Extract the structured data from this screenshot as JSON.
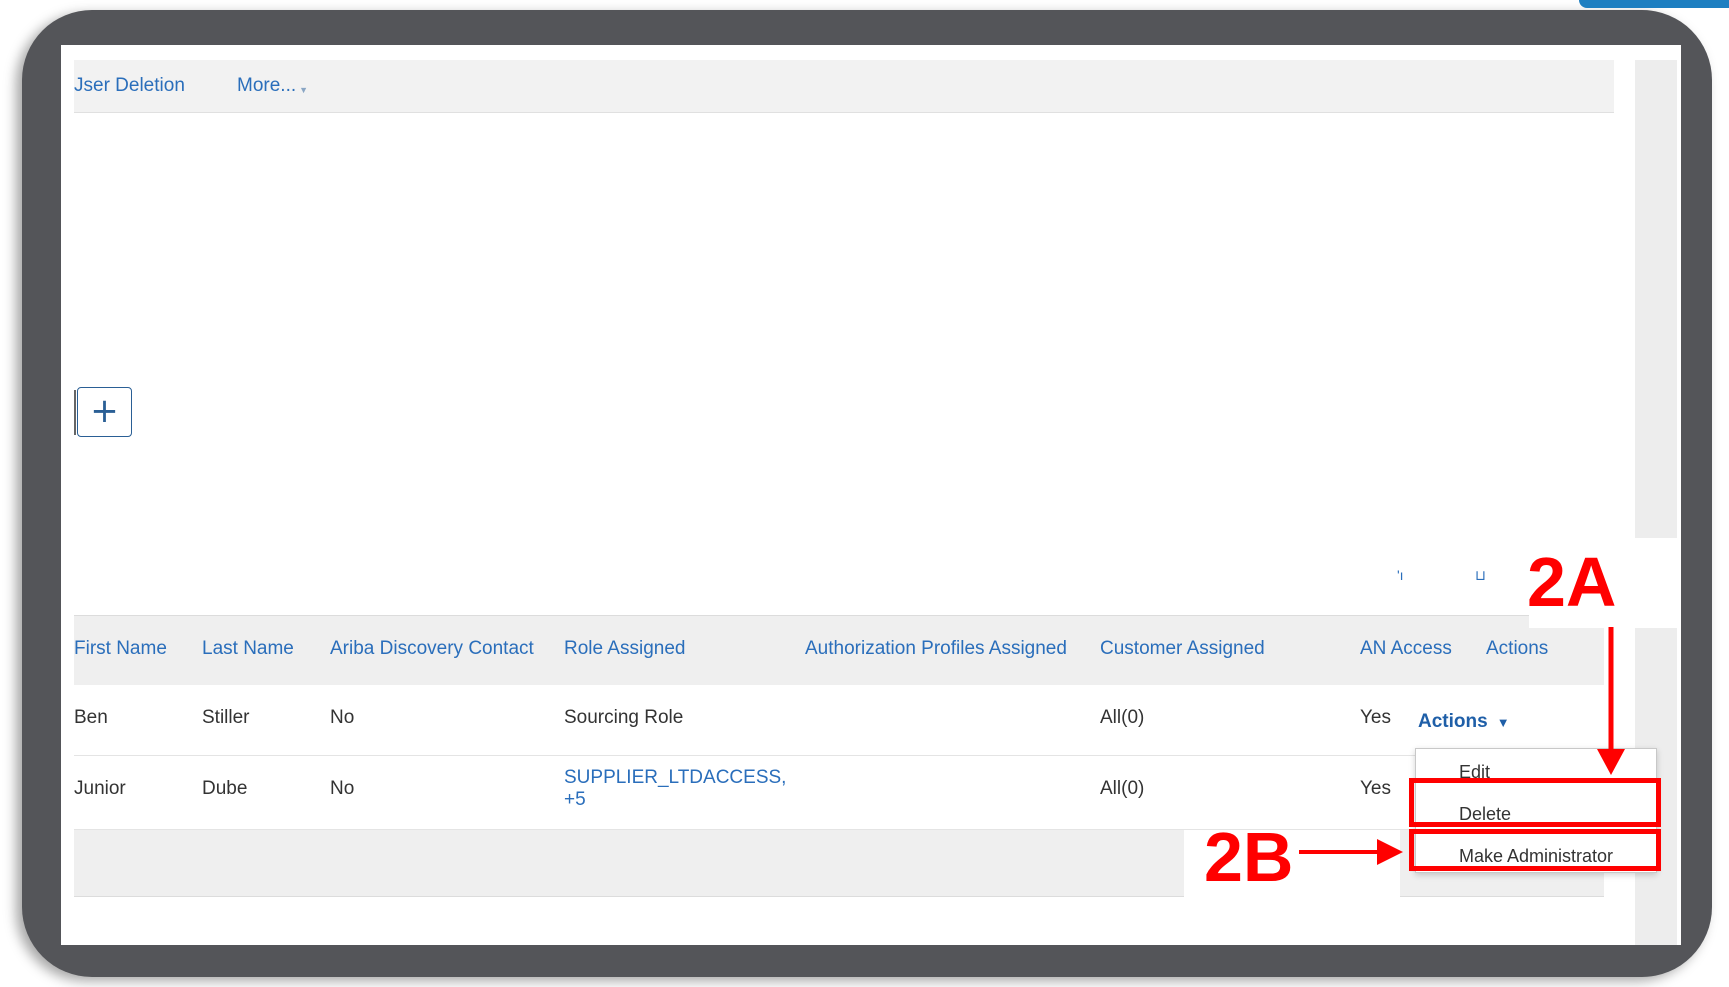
{
  "tabs": {
    "user_deletion": "Jser Deletion",
    "more": "More..."
  },
  "toolbar": {
    "add_symbol": "+",
    "icon_a": "'ı",
    "icon_b": "⊔",
    "icon_c": "▪▪▪"
  },
  "table": {
    "headers": [
      "First Name",
      "Last Name",
      "Ariba Discovery Contact",
      "Role Assigned",
      "Authorization Profiles Assigned",
      "Customer Assigned",
      "AN Access",
      "Actions"
    ],
    "rows": [
      {
        "first_name": "Ben",
        "last_name": "Stiller",
        "discovery_contact": "No",
        "role_assigned": "Sourcing Role",
        "role_assigned_more": "",
        "auth_profiles": "",
        "customer_assigned": "All(0)",
        "an_access": "Yes",
        "actions": "Actions"
      },
      {
        "first_name": "Junior",
        "last_name": "Dube",
        "discovery_contact": "No",
        "role_assigned": "SUPPLIER_LTDACCESS,",
        "role_assigned_more": "+5",
        "auth_profiles": "",
        "customer_assigned": "All(0)",
        "an_access": "Yes",
        "actions": ""
      }
    ]
  },
  "actions_menu": {
    "button_label": "Actions",
    "items": [
      "Edit",
      "Delete",
      "Make Administrator"
    ]
  },
  "annotations": {
    "step_2a": "2A",
    "step_2b": "2B",
    "color": "#ff0000"
  },
  "colors": {
    "link": "#2a6ebb",
    "bezel": "#545559",
    "header_bg": "#efefef"
  }
}
